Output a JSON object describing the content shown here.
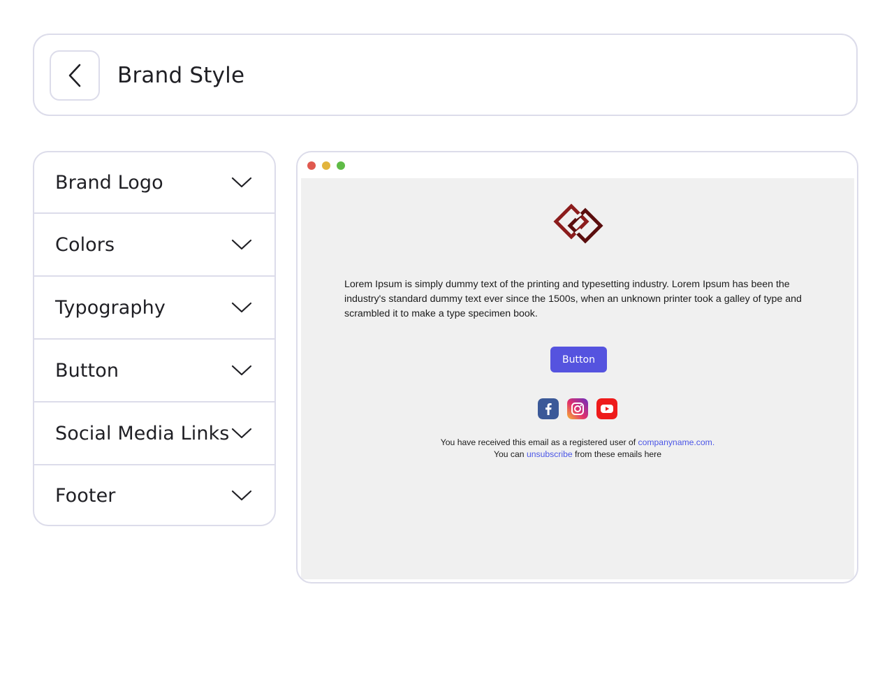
{
  "header": {
    "title": "Brand Style",
    "back_icon": "chevron-left-icon"
  },
  "accordion": {
    "items": [
      {
        "label": "Brand Logo"
      },
      {
        "label": "Colors"
      },
      {
        "label": "Typography"
      },
      {
        "label": "Button"
      },
      {
        "label": "Social Media Links"
      },
      {
        "label": "Footer"
      }
    ],
    "expand_icon": "chevron-down-icon"
  },
  "preview": {
    "window_dots": [
      "#e0594f",
      "#e2b43c",
      "#5fbb46"
    ],
    "body_text": "Lorem Ipsum is simply dummy text of the printing and typesetting industry. Lorem Ipsum has been the industry's standard dummy text ever since the 1500s, when an unknown printer took a galley of type and scrambled it to make a type specimen book.",
    "button_label": "Button",
    "socials": [
      "facebook-icon",
      "instagram-icon",
      "youtube-icon"
    ],
    "footer": {
      "line1_prefix": "You have received this email as a registered user of ",
      "line1_link": "companyname.com.",
      "line2_prefix": "You can ",
      "line2_link": "unsubscribe",
      "line2_suffix": " from these emails here"
    }
  },
  "colors": {
    "border": "#dcdcea",
    "accent": "#5553df",
    "link": "#4b56e6",
    "logo": "#8b1c1c"
  }
}
